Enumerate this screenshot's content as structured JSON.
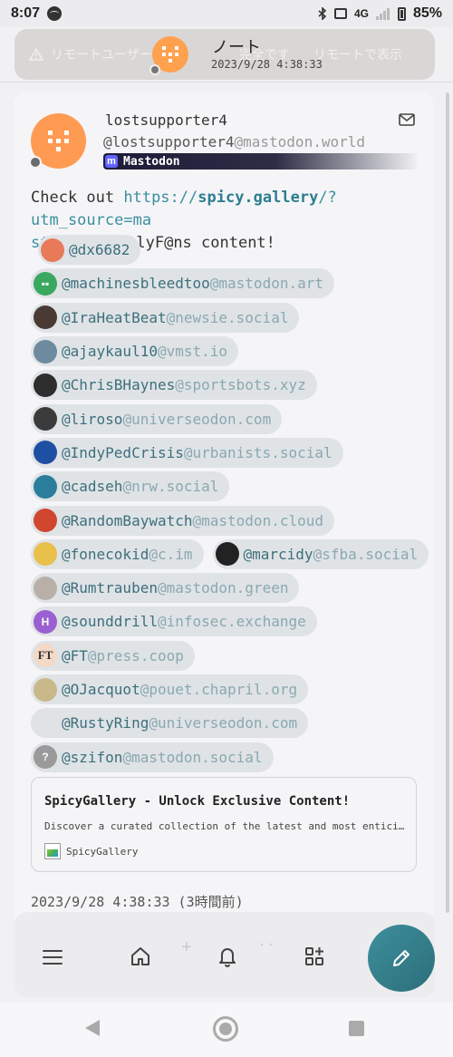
{
  "status_bar": {
    "time": "8:07",
    "network": "4G",
    "battery": "85%"
  },
  "header": {
    "warning": "リモートユーザー",
    "warning_tail": "完全です",
    "title": "ノート",
    "date": "2023/9/28 4:38:33",
    "remote_link": "リモートで表示"
  },
  "note": {
    "author_name": "lostsupporter4",
    "author_handle_user": "@lostsupporter4",
    "author_handle_host": "@mastodon.world",
    "instance": "Mastodon",
    "text_before": "Check out ",
    "link_scheme": "https://",
    "link_host": "spicy.gallery",
    "link_path_1": "/?utm_source=ma",
    "link_path_2": "st",
    "text_after": " for OnlyF@ns content!",
    "mentions": [
      [
        {
          "user": "@dx6682",
          "host": "",
          "avatar": "#e87a5a",
          "glyph": ""
        }
      ],
      [
        {
          "user": "@machinesbleedtoo",
          "host": "@mastodon.art",
          "avatar": "#3aa860",
          "glyph": "▪▪"
        }
      ],
      [
        {
          "user": "@IraHeatBeat",
          "host": "@newsie.social",
          "avatar": "#4a3a34",
          "glyph": ""
        }
      ],
      [
        {
          "user": "@ajaykaul10",
          "host": "@vmst.io",
          "avatar": "#6d8a9e",
          "glyph": ""
        }
      ],
      [
        {
          "user": "@ChrisBHaynes",
          "host": "@sportsbots.xyz",
          "avatar": "#2e2e2e",
          "glyph": ""
        }
      ],
      [
        {
          "user": "@liroso",
          "host": "@universeodon.com",
          "avatar": "#3b3b3b",
          "glyph": ""
        }
      ],
      [
        {
          "user": "@IndyPedCrisis",
          "host": "@urbanists.social",
          "avatar": "#1f4fa3",
          "glyph": ""
        }
      ],
      [
        {
          "user": "@cadseh",
          "host": "@nrw.social",
          "avatar": "#2a7d9b",
          "glyph": ""
        }
      ],
      [
        {
          "user": "@RandomBaywatch",
          "host": "@mastodon.cloud",
          "avatar": "#d0462e",
          "glyph": ""
        }
      ],
      [
        {
          "user": "@fonecokid",
          "host": "@c.im",
          "avatar": "#e8c04a",
          "glyph": ""
        },
        {
          "user": "@marcidy",
          "host": "@sfba.social",
          "avatar": "#222222",
          "glyph": ""
        }
      ],
      [
        {
          "user": "@Rumtrauben",
          "host": "@mastodon.green",
          "avatar": "#b8b0a8",
          "glyph": ""
        }
      ],
      [
        {
          "user": "@sounddrill",
          "host": "@infosec.exchange",
          "avatar": "#9a5fd0",
          "glyph": "H"
        }
      ],
      [
        {
          "user": "@FT",
          "host": "@press.coop",
          "avatar": "#f3d9c6",
          "glyph": "FT"
        }
      ],
      [
        {
          "user": "@OJacquot",
          "host": "@pouet.chapril.org",
          "avatar": "#c9b98a",
          "glyph": ""
        }
      ],
      [
        {
          "user": "@RustyRing",
          "host": "@universeodon.com",
          "avatar": "",
          "glyph": ""
        }
      ],
      [
        {
          "user": "@szifon",
          "host": "@mastodon.social",
          "avatar": "#9a9a9a",
          "glyph": "?"
        }
      ]
    ],
    "preview": {
      "title": "SpicyGallery - Unlock Exclusive Content!",
      "description": "Discover a curated collection of the latest and most enticing content from top creators.",
      "site": "SpicyGallery"
    },
    "footer_date": "2023/9/28 4:38:33 (3時間前)"
  },
  "nav": {
    "plus": "+",
    "dots": "··"
  },
  "colors": {
    "accent": "#3b8ea0",
    "fab": "#2f7280",
    "avatar": "#ff9a52",
    "instance_mastodon": "#6364ff"
  }
}
